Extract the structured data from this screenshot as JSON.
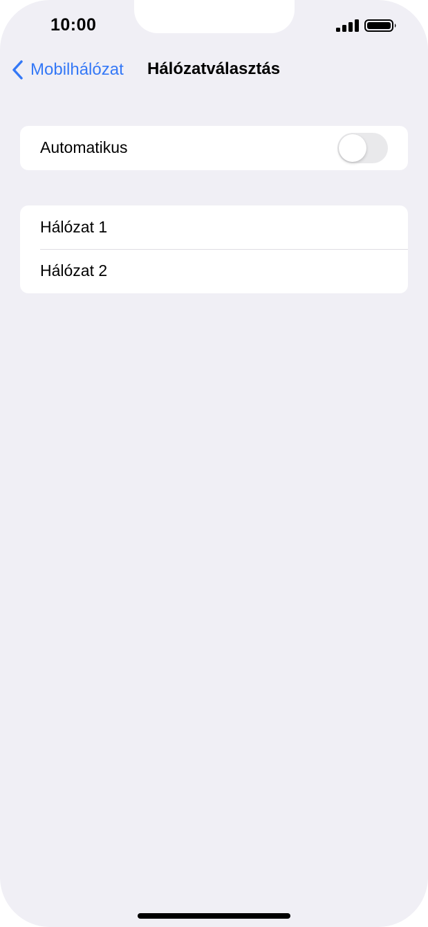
{
  "status_bar": {
    "time": "10:00",
    "signal_icon": "cellular-signal-icon",
    "battery_icon": "battery-icon"
  },
  "nav": {
    "back_label": "Mobilhálózat",
    "back_icon": "chevron-left-icon",
    "title": "Hálózatválasztás",
    "accent_color": "#3478f6"
  },
  "automatic": {
    "label": "Automatikus",
    "toggle_on": false
  },
  "networks": [
    {
      "label": "Hálózat 1"
    },
    {
      "label": "Hálózat 2"
    }
  ],
  "colors": {
    "background": "#f0eff5",
    "cell": "#ffffff",
    "toggle_off": "#e9e9eb"
  }
}
